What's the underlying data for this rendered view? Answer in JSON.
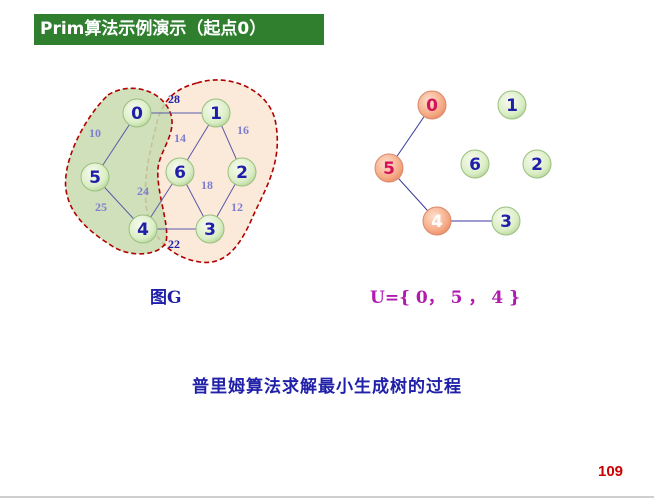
{
  "slide": {
    "title": "Prim算法示例演示（起点0）",
    "graph_caption": "图G",
    "set_caption": "U={ 0， 5 ， 4 }",
    "description": "普里姆算法求解最小生成树的过程",
    "page_number": "109"
  },
  "graph_g": {
    "nodes": [
      "0",
      "1",
      "2",
      "3",
      "4",
      "5",
      "6"
    ],
    "edge_weights": {
      "e01": "28",
      "e05": "10",
      "e16": "14",
      "e12": "16",
      "e46": "24",
      "e63": "18",
      "e54": "25",
      "e23": "12",
      "e43": "22"
    },
    "region_colors": {
      "u_set": "#c8dcb0",
      "v_minus_u": "#fbe9da",
      "border": "#b00000"
    }
  },
  "progress_tree": {
    "nodes": [
      "0",
      "1",
      "2",
      "3",
      "4",
      "5",
      "6"
    ],
    "in_u": [
      "0",
      "5",
      "4"
    ],
    "edges": [
      [
        "0",
        "5"
      ],
      [
        "5",
        "4"
      ],
      [
        "4",
        "3"
      ]
    ]
  },
  "colors": {
    "title_bg": "#2f7f2f",
    "node_green": "#dbeec6",
    "node_orange": "#f6ab86",
    "label_blue": "#1f1fa8",
    "weight_blue": "#7f7fd0",
    "caption_magenta": "#b01ab0",
    "page_number_red": "#cc0000"
  }
}
